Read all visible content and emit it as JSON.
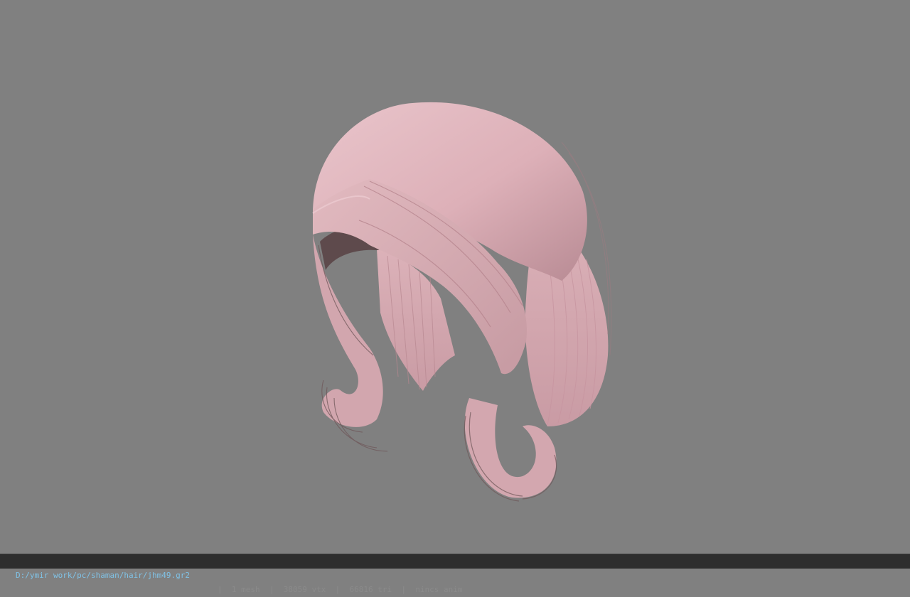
{
  "viewport": {
    "background": "#808080",
    "model": {
      "name": "hair-mesh",
      "color": "#e4bcc3",
      "shadow_color": "#6e5658"
    }
  },
  "statusbar": {
    "path": "D:/ymir work/pc/shaman/hair/jhm49.gr2",
    "separator": "|",
    "mesh_count": "1 mesh",
    "vertex_count": "38059 vtx",
    "triangle_count": "66816 tri",
    "anim": "nincs anim",
    "path_color": "#7fc2e6",
    "text_color": "#8a8a8a"
  }
}
